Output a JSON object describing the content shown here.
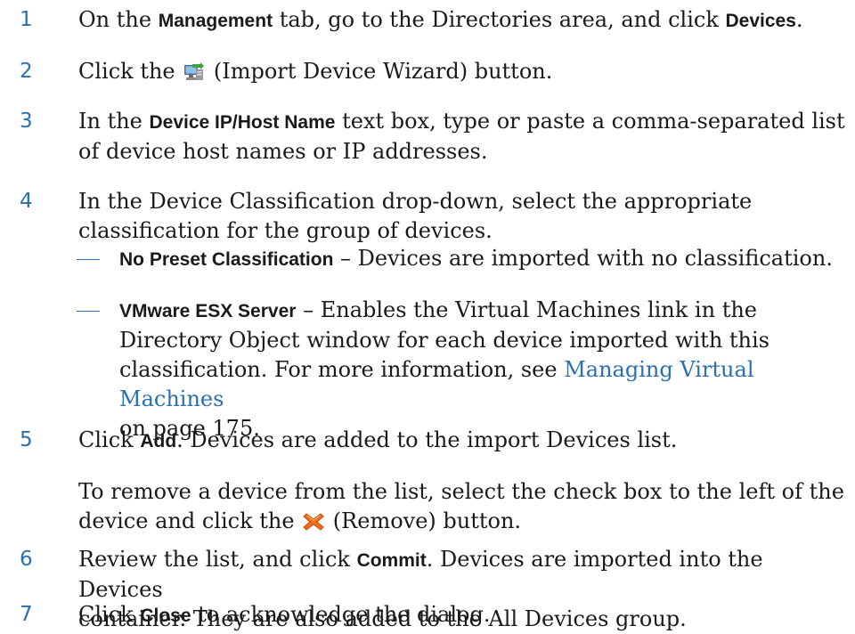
{
  "steps": {
    "s1": {
      "num": "1",
      "p1": "On the ",
      "b1": "Management",
      "p2": " tab, go to the Directories area, and click ",
      "b2": "Devices",
      "p3": "."
    },
    "s2": {
      "num": "2",
      "p1": "Click the ",
      "p2": " (Import Device Wizard) button."
    },
    "s3": {
      "num": "3",
      "p1": "In the ",
      "b1": "Device IP/Host Name",
      "p2": " text box, type or paste a comma-separated list",
      "l2": "of device host names or IP addresses."
    },
    "s4": {
      "num": "4",
      "l1": "In the Device Classification drop-down, select the appropriate",
      "l2": "classification for the group of devices."
    },
    "b1": {
      "b": "No Preset Classification",
      "p": " – Devices are imported with no classification."
    },
    "b2": {
      "b": "VMware ESX Server",
      "p": " – Enables the Virtual Machines link in the",
      "l2": "Directory Object window for each device imported with this",
      "l3a": "classification. For more information, see ",
      "link": "Managing Virtual Machines",
      "l4": "on page 175."
    },
    "s5": {
      "num": "5",
      "p1": "Click ",
      "b1": "Add",
      "p2": ". Devices are added to the import Devices list."
    },
    "s5n": {
      "l1": "To remove a device from the list, select the check box to the left of the",
      "l2a": "device and click the ",
      "l2b": " (Remove) button."
    },
    "s6": {
      "num": "6",
      "p1": "Review the list, and click ",
      "b1": "Commit",
      "p2": ". Devices are imported into the Devices",
      "l2": "container. They are also added to the All Devices group."
    },
    "s7": {
      "num": "7",
      "p1": "Click ",
      "b1": "Close",
      "p2": " to acknowledge the dialog."
    }
  },
  "icons": {
    "import_wizard": "import-device-wizard-icon",
    "remove": "remove-x-icon"
  },
  "colors": {
    "step_number": "#2a6fb0",
    "link": "#2a6fb0",
    "text": "#1a1a1a"
  }
}
